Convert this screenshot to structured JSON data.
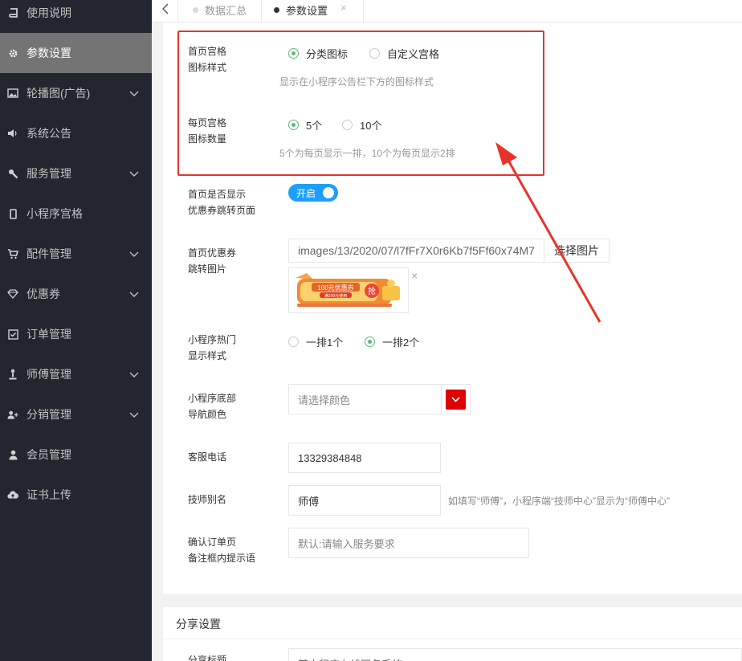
{
  "sidebar": {
    "items": [
      {
        "label": "使用说明",
        "icon": "book-icon"
      },
      {
        "label": "参数设置",
        "icon": "gear-icon"
      },
      {
        "label": "轮播图(广告)",
        "icon": "image-icon"
      },
      {
        "label": "系统公告",
        "icon": "volume-icon"
      },
      {
        "label": "服务管理",
        "icon": "wrench-icon"
      },
      {
        "label": "小程序宫格",
        "icon": "mobile-icon"
      },
      {
        "label": "配件管理",
        "icon": "cart-icon"
      },
      {
        "label": "优惠券",
        "icon": "diamond-icon"
      },
      {
        "label": "订单管理",
        "icon": "checkbox-icon"
      },
      {
        "label": "师傅管理",
        "icon": "worker-icon"
      },
      {
        "label": "分销管理",
        "icon": "user-plus-icon"
      },
      {
        "label": "会员管理",
        "icon": "user-icon"
      },
      {
        "label": "证书上传",
        "icon": "cloud-upload-icon"
      }
    ]
  },
  "tabs": {
    "items": [
      {
        "label": "数据汇总"
      },
      {
        "label": "参数设置"
      }
    ],
    "close": "×"
  },
  "form": {
    "grid_style": {
      "label_line1": "首页宫格",
      "label_line2": "图标样式",
      "option1": "分类图标",
      "option2": "自定义宫格",
      "selected": "分类图标",
      "hint": "显示在小程序公告栏下方的图标样式"
    },
    "grid_count": {
      "label_line1": "每页宫格",
      "label_line2": "图标数量",
      "option1": "5个",
      "option2": "10个",
      "selected": "5个",
      "hint": "5个为每页显示一排，10个为每页显示2排"
    },
    "coupon_jump": {
      "label_line1": "首页是否显示",
      "label_line2": "优惠券跳转页面",
      "toggle_text": "开启",
      "enabled": true
    },
    "coupon_image": {
      "label_line1": "首页优惠券",
      "label_line2": "跳转图片",
      "value": "images/13/2020/07/l7fFr7X0r6Kb7f5Ff60x74M7",
      "button": "选择图片",
      "thumb_title": "100元优惠券",
      "thumb_sub": "满299元使用",
      "thumb_badge": "抢",
      "remove": "×"
    },
    "hot_style": {
      "label_line1": "小程序热门",
      "label_line2": "显示样式",
      "option1": "一排1个",
      "option2": "一排2个",
      "selected": "一排2个"
    },
    "nav_color": {
      "label_line1": "小程序底部",
      "label_line2": "导航颜色",
      "placeholder": "请选择颜色",
      "color": "#e00000"
    },
    "phone": {
      "label": "客服电话",
      "value": "13329384848"
    },
    "tech_alias": {
      "label": "技师别名",
      "value": "师傅",
      "hint": "如填写“师傅”，小程序端“技师中心”显示为“师傅中心”"
    },
    "order_hint": {
      "label_line1": "确认订单页",
      "label_line2": "备注框内提示语",
      "placeholder": "默认:请输入服务要求"
    }
  },
  "share": {
    "title": "分享设置",
    "partial_label": "分享标题",
    "partial_value": "某小程序在线服务系统"
  },
  "colors": {
    "sidebar_bg": "#23262e",
    "active_bg": "#747474",
    "radio_on": "#5fb878",
    "toggle_on": "#1e9fff",
    "highlight": "#e8332b"
  }
}
